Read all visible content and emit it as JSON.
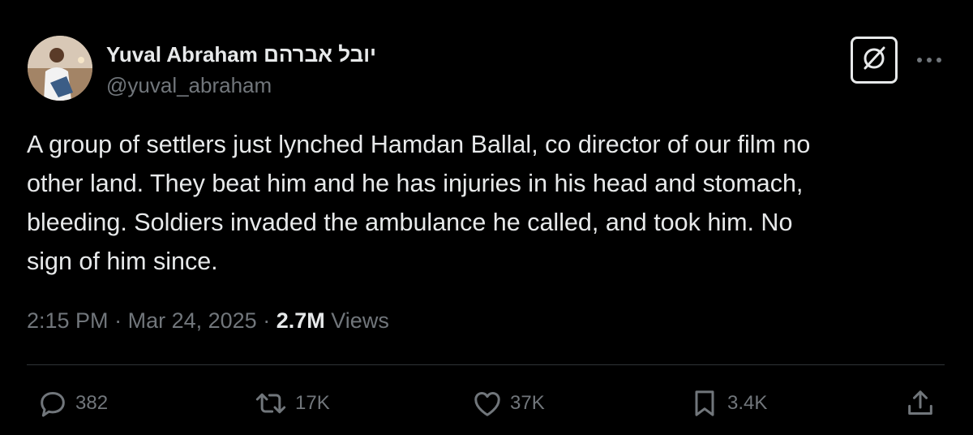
{
  "author": {
    "display_name": "Yuval Abraham יובל אברהם",
    "handle": "@yuval_abraham"
  },
  "tweet": {
    "text": "A group of settlers just lynched Hamdan Ballal, co director of our film no\nother land. They beat him and he has injuries in his head and stomach,\nbleeding. Soldiers invaded the ambulance he called, and took him. No\nsign of him since.",
    "time": "2:15 PM",
    "separator": "·",
    "date": "Mar 24, 2025",
    "views_count": "2.7M",
    "views_label": "Views"
  },
  "actions": {
    "reply_count": "382",
    "repost_count": "17K",
    "like_count": "37K",
    "bookmark_count": "3.4K"
  },
  "icons": {
    "grok": "grok-icon",
    "more": "more-icon",
    "reply": "reply-icon",
    "repost": "repost-icon",
    "like": "heart-icon",
    "bookmark": "bookmark-icon",
    "share": "share-icon"
  },
  "colors": {
    "background": "#000000",
    "text_primary": "#e7e9ea",
    "text_secondary": "#71767b",
    "divider": "#2f3336"
  }
}
